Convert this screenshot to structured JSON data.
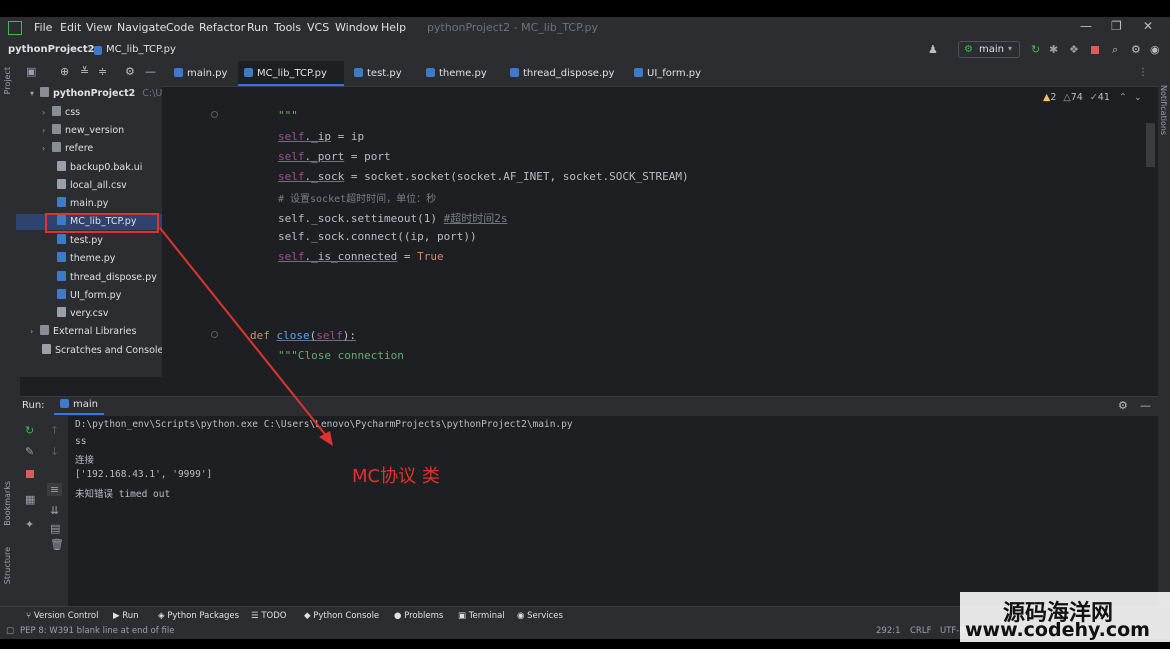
{
  "menubar": {
    "items": [
      "File",
      "Edit",
      "View",
      "Navigate",
      "Code",
      "Refactor",
      "Run",
      "Tools",
      "VCS",
      "Window",
      "Help"
    ],
    "window_title": "pythonProject2 - MC_lib_TCP.py"
  },
  "navbar": {
    "project": "pythonProject2",
    "file": "MC_lib_TCP.py",
    "branch": "main"
  },
  "project_tree": {
    "root": "pythonProject2",
    "root_path": "C:\\Use",
    "items": [
      {
        "label": "css"
      },
      {
        "label": "new_version"
      },
      {
        "label": "refere"
      },
      {
        "label": "backup0.bak.ui"
      },
      {
        "label": "local_all.csv"
      },
      {
        "label": "main.py"
      },
      {
        "label": "MC_lib_TCP.py"
      },
      {
        "label": "test.py"
      },
      {
        "label": "theme.py"
      },
      {
        "label": "thread_dispose.py"
      },
      {
        "label": "UI_form.py"
      },
      {
        "label": "very.csv"
      }
    ],
    "external": "External Libraries",
    "scratches": "Scratches and Consoles"
  },
  "tabs": [
    "main.py",
    "MC_lib_TCP.py",
    "test.py",
    "theme.py",
    "thread_dispose.py",
    "UI_form.py"
  ],
  "inspections": {
    "warnings": "2",
    "weak": "74",
    "typos": "41"
  },
  "code": {
    "l1": "\"\"\"",
    "l2_a": "self",
    "l2_b": "._ip",
    "l2_c": " = ip",
    "l3_a": "self",
    "l3_b": "._port",
    "l3_c": " = port",
    "l4_a": "self",
    "l4_b": "._sock",
    "l4_c": " = socket.socket(socket.AF_INET, socket.SOCK_STREAM)",
    "l5": "# 设置socket超时时间，单位：秒",
    "l6_a": "self._sock.settimeout(1) ",
    "l6_b": "#超时时间2s",
    "l7": "self._sock.connect((ip, port))",
    "l8_a": "self",
    "l8_b": "._is_connected",
    "l8_c": " = ",
    "l8_d": "True",
    "l9_kw": "def ",
    "l9_fn": "close",
    "l9_p1": "(",
    "l9_self": "self",
    "l9_p2": "):",
    "l10": "\"\"\"Close connection"
  },
  "run": {
    "label": "Run:",
    "config": "main",
    "lines": [
      "D:\\python_env\\Scripts\\python.exe C:\\Users\\Lenovo\\PycharmProjects\\pythonProject2\\main.py",
      "ss",
      "连接",
      "['192.168.43.1', '9999']",
      "未知错误 timed out"
    ]
  },
  "bottom_tabs": [
    "Version Control",
    "Run",
    "Python Packages",
    "TODO",
    "Python Console",
    "Problems",
    "Terminal",
    "Services"
  ],
  "status": {
    "message": "PEP 8: W391 blank line at end of file",
    "position": "292:1",
    "line_sep": "CRLF",
    "encoding": "UTF-8"
  },
  "side_labels": {
    "project": "Project",
    "bookmarks": "Bookmarks",
    "structure": "Structure",
    "notifications": "Notifications"
  },
  "annotation": "MC协议 类",
  "watermark": {
    "line1": "源码海洋网",
    "line2": "www.codehy.com"
  },
  "colors": {
    "annotation_red": "#e0332e",
    "accent_blue": "#3574f0",
    "keyword": "#cf8e6d",
    "self": "#94558d",
    "function": "#56a8f5",
    "comment": "#7a7e85"
  }
}
